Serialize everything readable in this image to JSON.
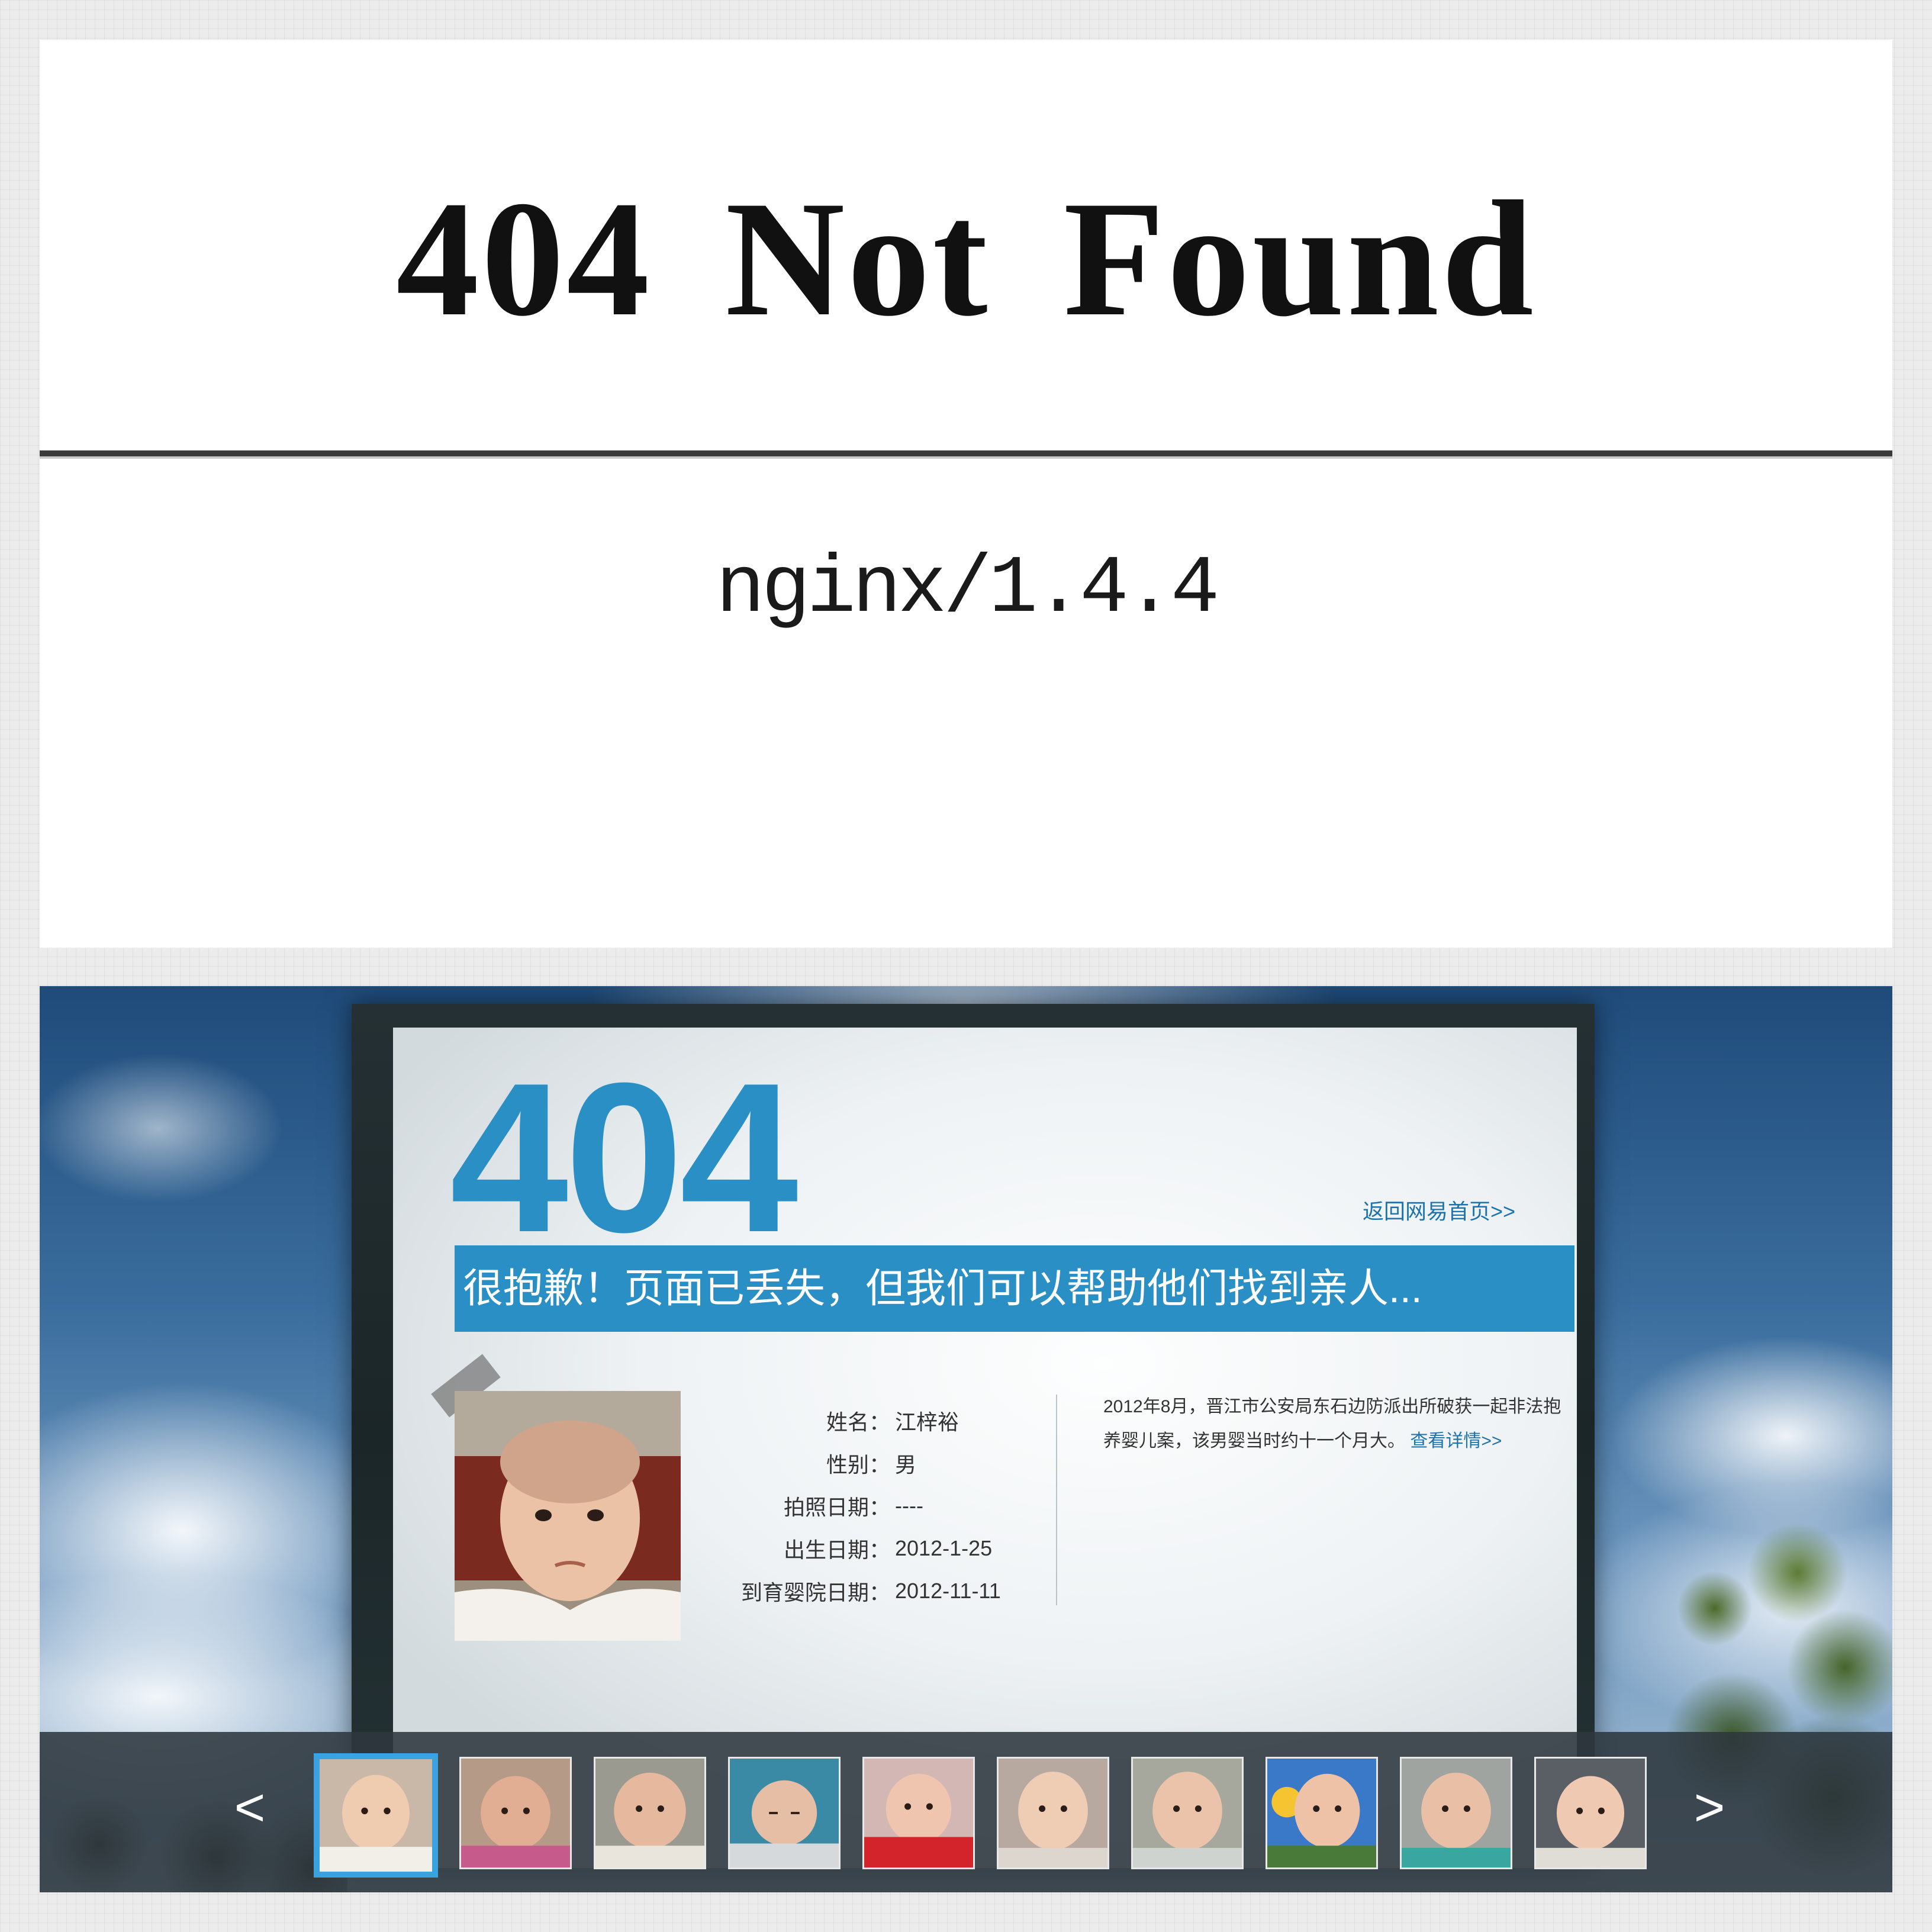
{
  "nginx_page": {
    "title": "404 Not Found",
    "server": "nginx/1.4.4"
  },
  "netease_page": {
    "error_code": "404",
    "home_link": "返回网易首页>>",
    "banner": "很抱歉！页面已丢失，但我们可以帮助他们找到亲人...",
    "child": {
      "fields": [
        {
          "label": "姓名：",
          "value": "江梓裕"
        },
        {
          "label": "性别：",
          "value": "男"
        },
        {
          "label": "拍照日期：",
          "value": "----"
        },
        {
          "label": "出生日期：",
          "value": "2012-1-25"
        },
        {
          "label": "到育婴院日期：",
          "value": "2012-11-11"
        }
      ],
      "description": "2012年8月，晋江市公安局东石边防派出所破获一起非法抱养婴儿案，该男婴当时约十一个月大。",
      "details_link": "查看详情>>"
    },
    "carousel": {
      "prev": "<",
      "next": ">",
      "active_index": 0,
      "thumb_count": 10
    },
    "colors": {
      "accent": "#2a8fc4",
      "link": "#1c73ad",
      "active_border": "#3aa3df"
    }
  }
}
